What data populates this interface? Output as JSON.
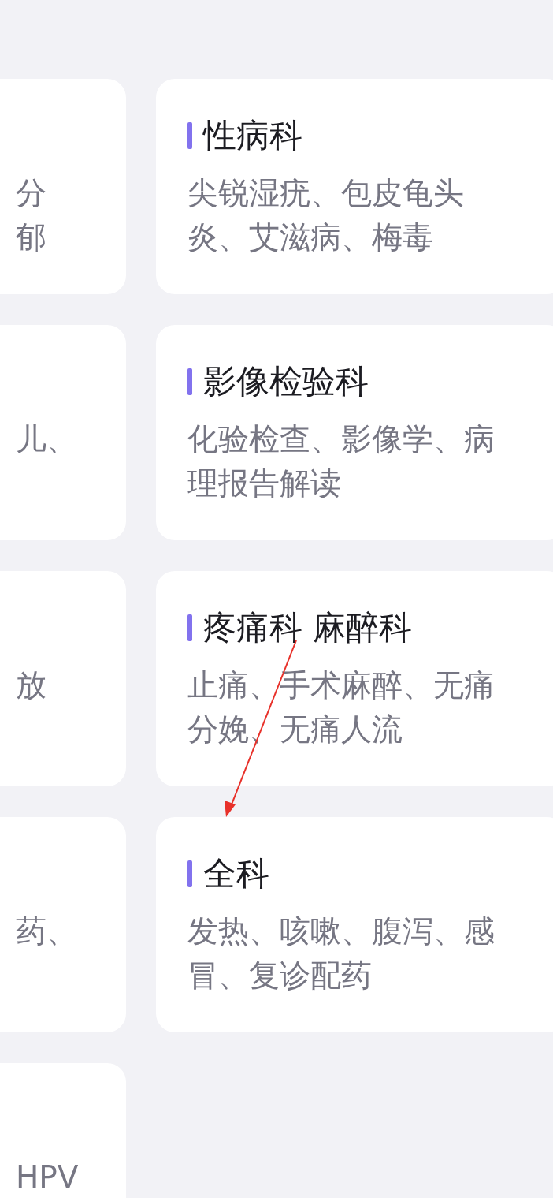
{
  "rows": [
    {
      "left": {
        "lines": [
          "分",
          "郁"
        ]
      },
      "right": {
        "title": "性病科",
        "description": "尖锐湿疣、包皮龟头炎、艾滋病、梅毒"
      }
    },
    {
      "left": {
        "lines": [
          "儿、"
        ]
      },
      "right": {
        "title": "影像检验科",
        "description": "化验检查、影像学、病理报告解读"
      }
    },
    {
      "left": {
        "lines": [
          "放"
        ]
      },
      "right": {
        "title": "疼痛科 麻醉科",
        "description": "止痛、手术麻醉、无痛分娩、无痛人流"
      }
    },
    {
      "left": {
        "lines": [
          "药、"
        ]
      },
      "right": {
        "title": "全科",
        "description": "发热、咳嗽、腹泻、感冒、复诊配药"
      }
    },
    {
      "left": {
        "lines": [
          "HPV"
        ]
      }
    }
  ],
  "annotations": [
    {
      "kind": "arrow",
      "color": "#e8312a"
    }
  ]
}
